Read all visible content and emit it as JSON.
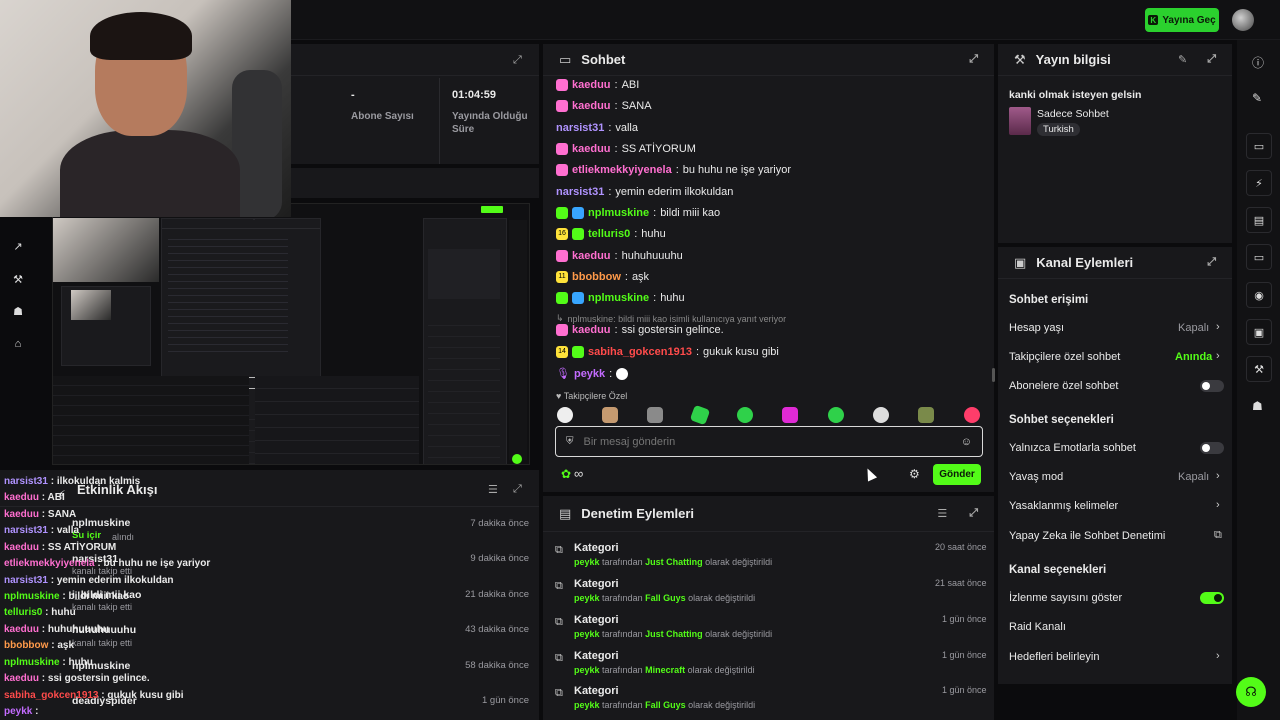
{
  "topbar": {
    "go_live_label": "Yayına Geç"
  },
  "stats": {
    "subs_value": "-",
    "subs_label": "Abone Sayısı",
    "duration_value": "01:04:59",
    "duration_label_1": "Yayında Olduğu",
    "duration_label_2": "Süre"
  },
  "chat": {
    "title": "Sohbet",
    "messages": [
      {
        "user": "kaeduu",
        "text": "ABI"
      },
      {
        "user": "kaeduu",
        "text": "SANA"
      },
      {
        "user": "narsist31",
        "text": "valla"
      },
      {
        "user": "kaeduu",
        "text": "SS ATİYORUM"
      },
      {
        "user": "etliekmekkyiyenela",
        "text": "bu huhu ne işe yariyor"
      },
      {
        "user": "narsist31",
        "text": "yemin ederim ilkokuldan"
      },
      {
        "user": "nplmuskine",
        "text": "bildi miii kao"
      },
      {
        "user": "telluris0",
        "text": "huhu"
      },
      {
        "user": "kaeduu",
        "text": "huhuhuuuhu"
      },
      {
        "user": "bbobbow",
        "text": "aşk"
      },
      {
        "user": "nplmuskine",
        "text": "huhu"
      },
      {
        "user": "kaeduu",
        "text": "ssi gostersin gelince."
      },
      {
        "user": "sabiha_gokcen1913",
        "text": "gukuk kusu gibi"
      },
      {
        "user": "peykk",
        "text": ""
      }
    ],
    "reply_note": "nplmuskine: bildi miii kao isimli kullanıcıya yanıt veriyor",
    "badge_16": "16",
    "badge_11": "11",
    "badge_14": "14",
    "followers_only": "Takipçilere Özel",
    "input_placeholder": "Bir mesaj gönderin",
    "send_label": "Gönder"
  },
  "stream_info": {
    "title": "Yayın bilgisi",
    "stream_title": "kanki olmak isteyen gelsin",
    "category": "Sadece Sohbet",
    "language": "Turkish"
  },
  "channel_actions": {
    "title": "Kanal Eylemleri",
    "chat_access": "Sohbet erişimi",
    "account_age": "Hesap yaşı",
    "account_age_value": "Kapalı",
    "followers_chat": "Takipçilere özel sohbet",
    "followers_chat_value": "Anında",
    "subs_chat": "Abonelere özel sohbet",
    "chat_options": "Sohbet seçenekleri",
    "emote_only": "Yalnızca Emotlarla sohbet",
    "slow_mode": "Yavaş mod",
    "slow_mode_value": "Kapalı",
    "banned_words": "Yasaklanmış kelimeler",
    "ai_moderation": "Yapay Zeka ile Sohbet Denetimi",
    "channel_options": "Kanal seçenekleri",
    "show_viewers": "İzlenme sayısını göster",
    "raid": "Raid Kanalı",
    "goals": "Hedefleri belirleyin"
  },
  "activity": {
    "title": "Etkinlik Akışı",
    "items": [
      {
        "user": "nplmuskine",
        "action": "Su içir",
        "sub": "alındı",
        "time": "7 dakika önce"
      },
      {
        "user": "narsist31",
        "action": "",
        "sub": "kanalı takip etti",
        "time": "9 dakika önce"
      },
      {
        "user": "i_bildi mii kao",
        "action": "",
        "sub": "kanalı takip etti",
        "time": "21 dakika önce"
      },
      {
        "user": "huhuhuuuhu",
        "action": "",
        "sub": "kanalı takip etti",
        "time": "43 dakika önce"
      },
      {
        "user": "nplmuskine",
        "action": "",
        "sub": "",
        "time": "58 dakika önce"
      },
      {
        "user": "deadiyspider",
        "action": "",
        "sub": "",
        "time": "1 gün önce"
      }
    ]
  },
  "overlay_chat": [
    {
      "user": "narsist31",
      "text": "ilkokuldan kalmis"
    },
    {
      "user": "kaeduu",
      "text": "ABI"
    },
    {
      "user": "kaeduu",
      "text": "SANA"
    },
    {
      "user": "narsist31",
      "text": "valla"
    },
    {
      "user": "kaeduu",
      "text": "SS ATİYORUM"
    },
    {
      "user": "etliekmekkyiyenela",
      "text": "bu huhu ne işe yariyor"
    },
    {
      "user": "narsist31",
      "text": "yemin ederim ilkokuldan"
    },
    {
      "user": "nplmuskine",
      "text": "bildi miii kao"
    },
    {
      "user": "telluris0",
      "text": "huhu"
    },
    {
      "user": "kaeduu",
      "text": "huhuhuuuhu"
    },
    {
      "user": "bbobbow",
      "text": "aşk"
    },
    {
      "user": "nplmuskine",
      "text": "huhu"
    },
    {
      "user": "kaeduu",
      "text": "ssi gostersin gelince."
    },
    {
      "user": "sabiha_gokcen1913",
      "text": "gukuk kusu gibi"
    },
    {
      "user": "peykk",
      "text": ""
    }
  ],
  "moderation": {
    "title": "Denetim Eylemleri",
    "items": [
      {
        "title": "Kategori",
        "by": "peykk",
        "mid": "tarafından",
        "value": "Just Chatting",
        "end": "olarak değiştirildi",
        "time": "20 saat önce"
      },
      {
        "title": "Kategori",
        "by": "peykk",
        "mid": "tarafından",
        "value": "Fall Guys",
        "end": "olarak değiştirildi",
        "time": "21 saat önce"
      },
      {
        "title": "Kategori",
        "by": "peykk",
        "mid": "tarafından",
        "value": "Just Chatting",
        "end": "olarak değiştirildi",
        "time": "1 gün önce"
      },
      {
        "title": "Kategori",
        "by": "peykk",
        "mid": "tarafından",
        "value": "Minecraft",
        "end": "olarak değiştirildi",
        "time": "1 gün önce"
      },
      {
        "title": "Kategori",
        "by": "peykk",
        "mid": "tarafından",
        "value": "Fall Guys",
        "end": "olarak değiştirildi",
        "time": "1 gün önce"
      }
    ]
  }
}
